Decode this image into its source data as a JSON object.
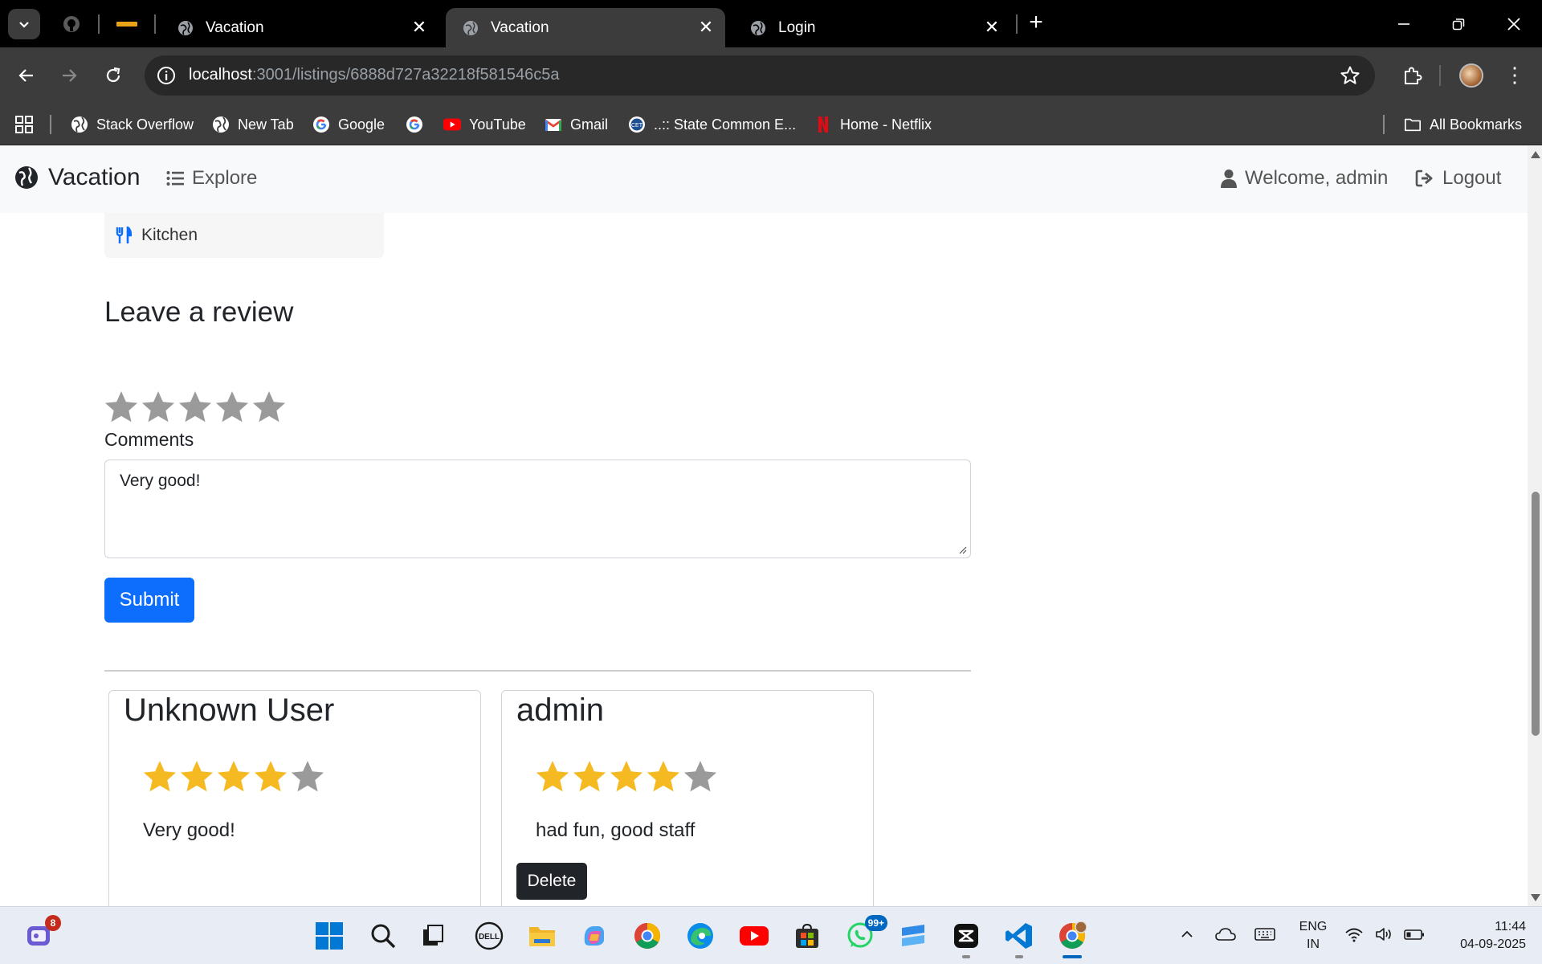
{
  "browser": {
    "tabs": [
      {
        "title": "Vacation",
        "active": false
      },
      {
        "title": "Vacation",
        "active": true
      },
      {
        "title": "Login",
        "active": false
      }
    ],
    "url_host": "localhost",
    "url_rest": ":3001/listings/6888d727a32218f581546c5a",
    "bookmarks": [
      {
        "label": "Stack Overflow",
        "icon": "globe-icon"
      },
      {
        "label": "New Tab",
        "icon": "globe-icon"
      },
      {
        "label": "Google",
        "icon": "google-icon"
      },
      {
        "label": "",
        "icon": "google-icon"
      },
      {
        "label": "YouTube",
        "icon": "youtube-icon"
      },
      {
        "label": "Gmail",
        "icon": "gmail-icon"
      },
      {
        "label": "..:: State Common E...",
        "icon": "cet-icon"
      },
      {
        "label": "Home - Netflix",
        "icon": "netflix-icon"
      }
    ],
    "all_bookmarks": "All Bookmarks"
  },
  "site": {
    "brand": "Vacation",
    "explore": "Explore",
    "welcome": "Welcome, admin",
    "logout": "Logout"
  },
  "listing": {
    "amenity": "Kitchen",
    "review_form": {
      "title": "Leave a review",
      "rating": 0,
      "rating_max": 5,
      "comments_label": "Comments",
      "comment_value": "Very good!",
      "submit_label": "Submit"
    },
    "reviews": [
      {
        "author": "Unknown User",
        "rating": 4,
        "rating_max": 5,
        "comment": "Very good!",
        "can_delete": false
      },
      {
        "author": "admin",
        "rating": 4,
        "rating_max": 5,
        "comment": "had fun, good staff",
        "can_delete": true,
        "delete_label": "Delete"
      }
    ]
  },
  "taskbar": {
    "notifications_badge": "8",
    "whatsapp_badge": "99+",
    "language": "ENG",
    "region": "IN",
    "time": "11:44",
    "date": "04-09-2025"
  },
  "colors": {
    "primary": "#0d6efd",
    "star_filled": "#f5b922",
    "star_empty": "#9a9a9a",
    "dark_button": "#212529"
  }
}
